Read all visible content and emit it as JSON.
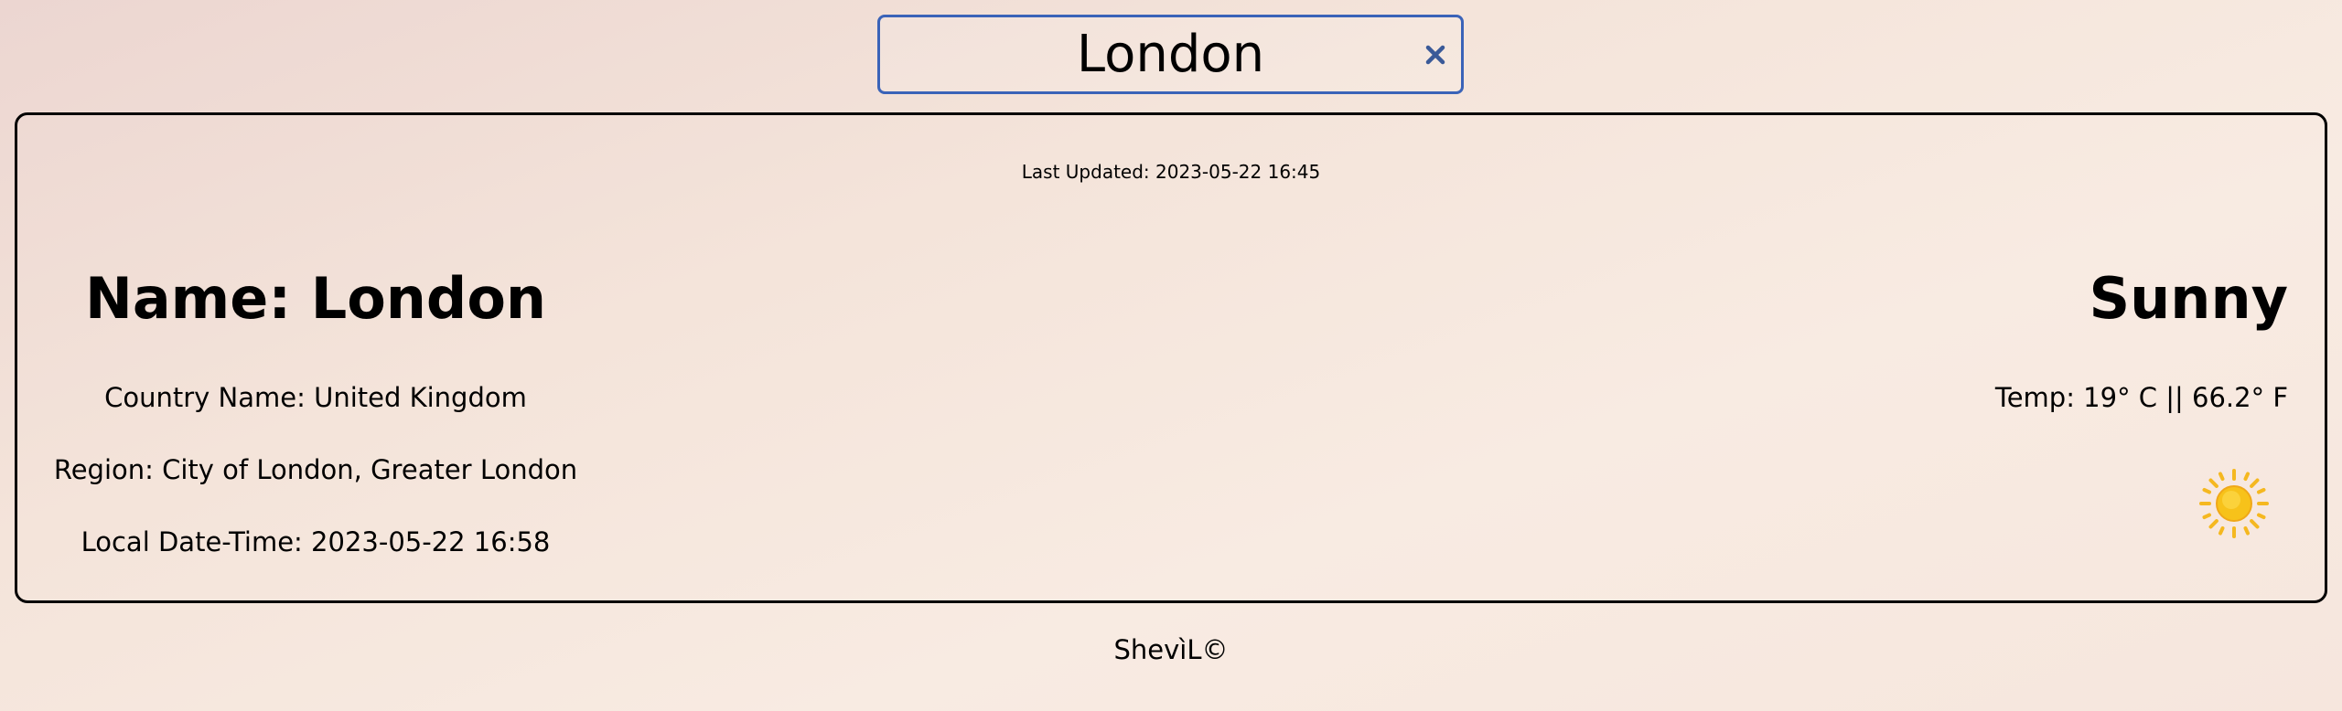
{
  "search": {
    "value": "London",
    "clear_icon": "close-icon"
  },
  "weather": {
    "last_updated": "Last Updated: 2023-05-22 16:45",
    "name": "Name: London",
    "country": "Country Name: United Kingdom",
    "region": "Region: City of London, Greater London",
    "local_time": "Local Date-Time: 2023-05-22 16:58",
    "condition": "Sunny",
    "temp": "Temp: 19° C || 66.2° F",
    "icon": "sun-icon"
  },
  "footer": {
    "text": "ShevìL©"
  },
  "colors": {
    "search_border": "#3a63b8",
    "clear_icon": "#3a5a98",
    "sun": "#f7c21a"
  }
}
